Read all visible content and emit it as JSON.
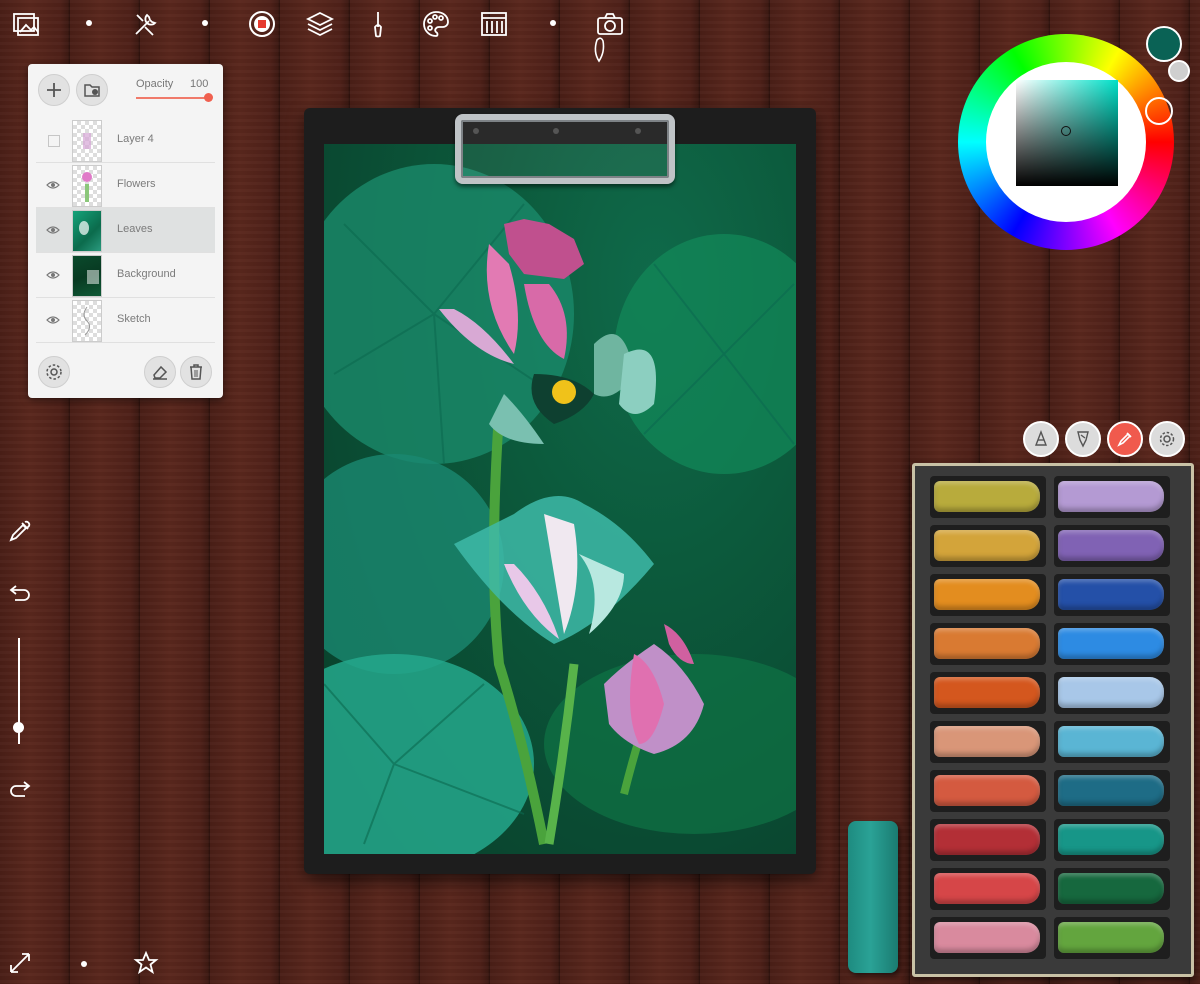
{
  "toolbar": {
    "items": [
      {
        "name": "gallery-icon"
      },
      {
        "name": "tools-icon"
      },
      {
        "name": "record-icon"
      },
      {
        "name": "layers-icon"
      },
      {
        "name": "brush-icon"
      },
      {
        "name": "palette-icon"
      },
      {
        "name": "pastel-set-icon"
      },
      {
        "name": "camera-icon"
      }
    ]
  },
  "layers_panel": {
    "opacity_label": "Opacity",
    "opacity_value": "100",
    "opacity_fraction": 1.0,
    "layers": [
      {
        "name": "Layer 4",
        "visible": false,
        "selected": false
      },
      {
        "name": "Flowers",
        "visible": true,
        "selected": false
      },
      {
        "name": "Leaves",
        "visible": true,
        "selected": true
      },
      {
        "name": "Background",
        "visible": true,
        "selected": false
      },
      {
        "name": "Sketch",
        "visible": true,
        "selected": false
      }
    ]
  },
  "color_picker": {
    "current_color": "#0a6255",
    "hue_color": "#00e0c8"
  },
  "brush_size_fraction": 0.16,
  "pastel_tools": [
    "pencil-tip-icon",
    "blend-tip-icon",
    "eyedropper-tip-icon",
    "settings-icon"
  ],
  "pastels": {
    "left_column": [
      "#b8ab3c",
      "#d3a43a",
      "#e38d1f",
      "#d97a32",
      "#d4571e",
      "#d99678",
      "#d45a40",
      "#b32f36",
      "#d64648",
      "#d98a9e"
    ],
    "right_column": [
      "#b49ad3",
      "#8062b4",
      "#2450a8",
      "#2d8be3",
      "#a8c7e8",
      "#5ab5d4",
      "#1e6c86",
      "#179688",
      "#16683e",
      "#63a53e"
    ],
    "loose_pastel_color": "#2aa296"
  }
}
